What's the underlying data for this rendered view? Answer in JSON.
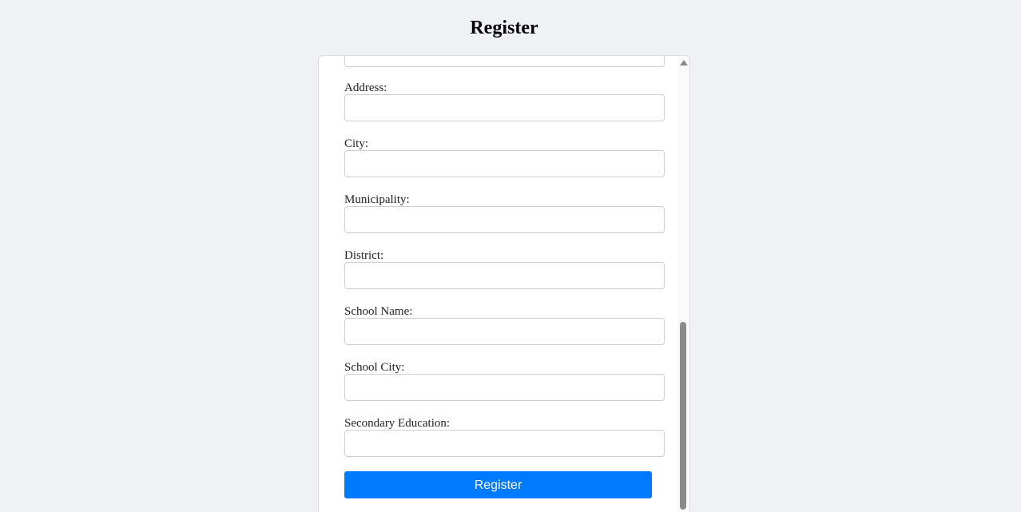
{
  "page": {
    "title": "Register"
  },
  "form": {
    "fields": [
      {
        "label": "",
        "value": ""
      },
      {
        "label": "Address:",
        "value": ""
      },
      {
        "label": "City:",
        "value": ""
      },
      {
        "label": "Municipality:",
        "value": ""
      },
      {
        "label": "District:",
        "value": ""
      },
      {
        "label": "School Name:",
        "value": ""
      },
      {
        "label": "School City:",
        "value": ""
      },
      {
        "label": "Secondary Education:",
        "value": ""
      }
    ],
    "submit_label": "Register"
  },
  "colors": {
    "background": "#f0f1f5",
    "button": "#007bff",
    "scroll_thumb": "#8a8a8a"
  }
}
